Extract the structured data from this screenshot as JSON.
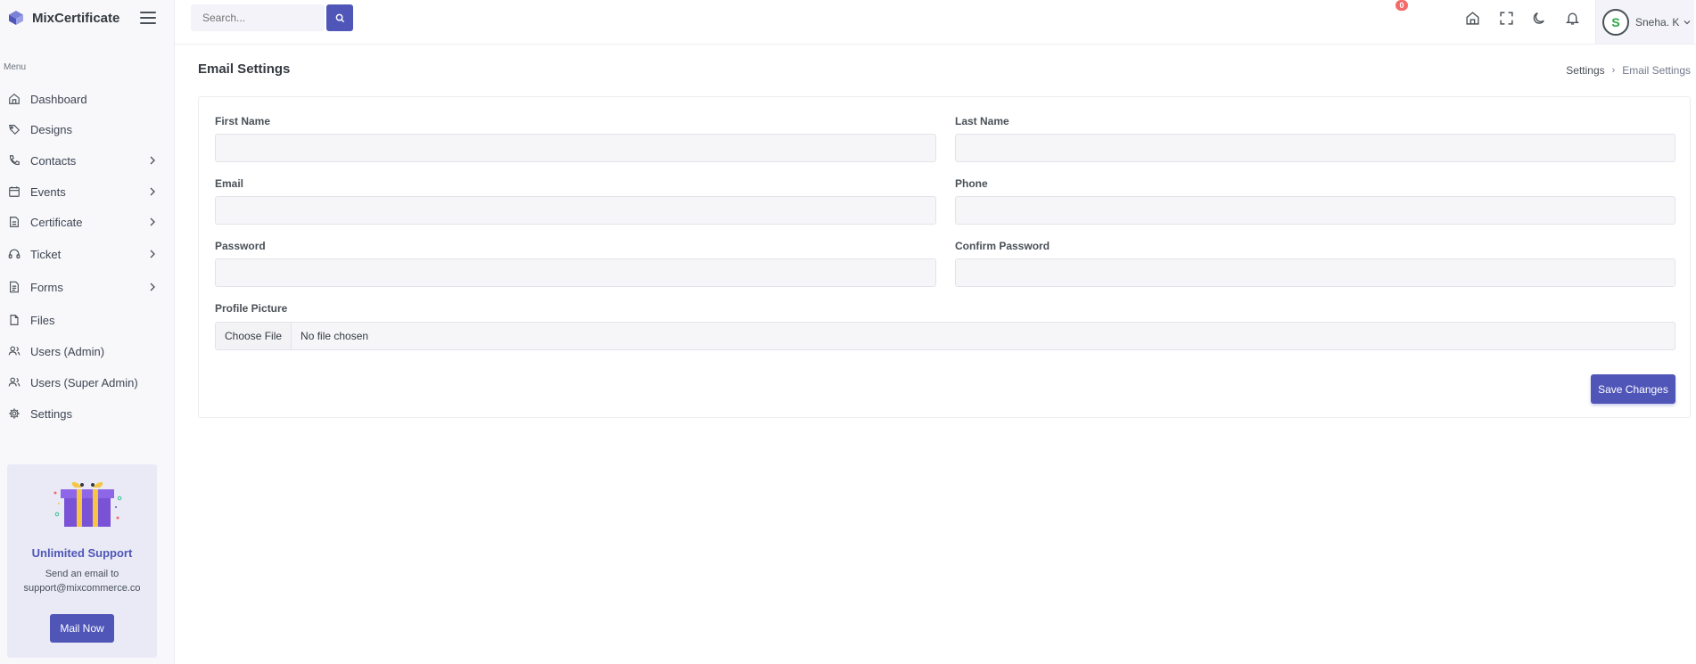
{
  "brand": {
    "name": "MixCertificate"
  },
  "sidebar": {
    "menu_title": "Menu",
    "items": [
      {
        "label": "Dashboard",
        "icon": "home-icon",
        "has_submenu": false
      },
      {
        "label": "Designs",
        "icon": "brush-icon",
        "has_submenu": false
      },
      {
        "label": "Contacts",
        "icon": "phone-icon",
        "has_submenu": true
      },
      {
        "label": "Events",
        "icon": "calendar-icon",
        "has_submenu": true
      },
      {
        "label": "Certificate",
        "icon": "document-icon",
        "has_submenu": true
      },
      {
        "label": "Ticket",
        "icon": "headset-icon",
        "has_submenu": true
      },
      {
        "label": "Forms",
        "icon": "form-icon",
        "has_submenu": true
      },
      {
        "label": "Files",
        "icon": "file-icon",
        "has_submenu": false
      },
      {
        "label": "Users (Admin)",
        "icon": "users-icon",
        "has_submenu": false
      },
      {
        "label": "Users (Super Admin)",
        "icon": "users-icon",
        "has_submenu": false
      },
      {
        "label": "Settings",
        "icon": "gear-icon",
        "has_submenu": false
      }
    ],
    "support": {
      "title": "Unlimited Support",
      "text_line1": "Send an email to",
      "text_line2": "support@mixcommerce.co",
      "button": "Mail Now"
    }
  },
  "topbar": {
    "search_placeholder": "Search...",
    "notification_count": "0",
    "user_name": "Sneha. K",
    "avatar_letter": "S"
  },
  "page": {
    "title": "Email Settings",
    "breadcrumb": [
      "Settings",
      "Email Settings"
    ]
  },
  "form": {
    "first_name": {
      "label": "First Name",
      "value": ""
    },
    "last_name": {
      "label": "Last Name",
      "value": ""
    },
    "email": {
      "label": "Email",
      "value": ""
    },
    "phone": {
      "label": "Phone",
      "value": ""
    },
    "password": {
      "label": "Password",
      "value": ""
    },
    "confirm_password": {
      "label": "Confirm Password",
      "value": ""
    },
    "profile_picture": {
      "label": "Profile Picture",
      "button": "Choose File",
      "status": "No file chosen"
    },
    "save_button": "Save Changes"
  },
  "colors": {
    "primary": "#4f56b8",
    "sidebar_bg": "#f8f8fb",
    "badge": "#f46a6a"
  }
}
